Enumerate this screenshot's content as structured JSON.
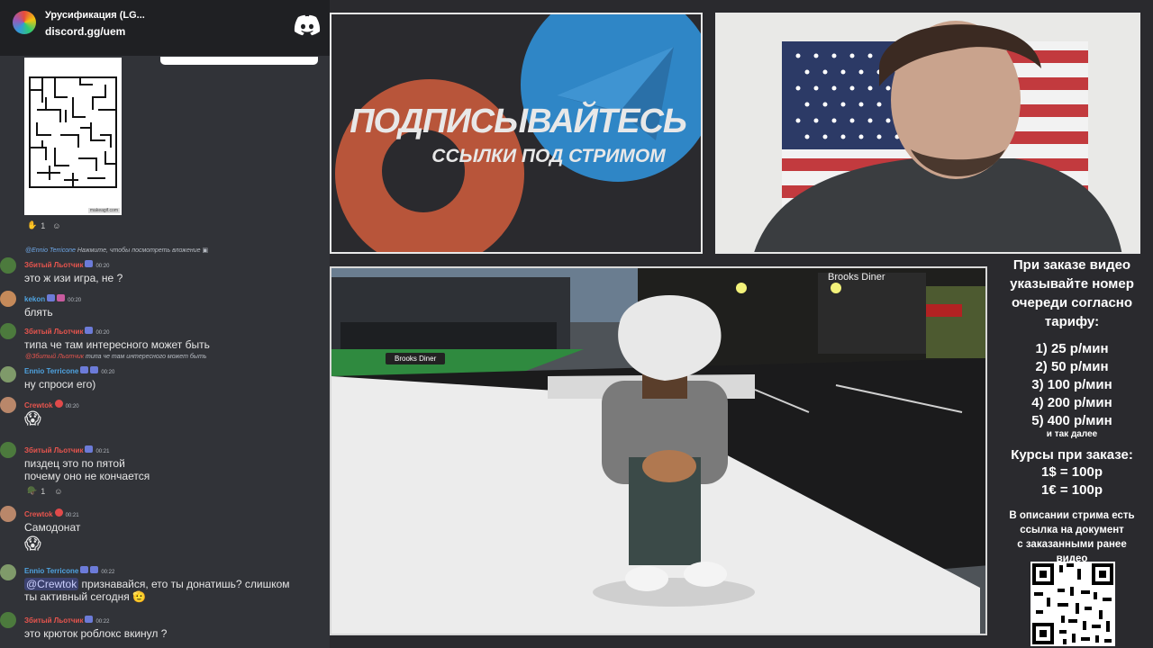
{
  "chat": {
    "server_name": "Урусификация (LG...",
    "server_invite": "discord.gg/uem",
    "maze_watermark": "makeagif.com",
    "maze_reactions": [
      {
        "icon": "raised-hand-icon",
        "count": "1"
      },
      {
        "icon": "add-reaction-icon",
        "count": ""
      }
    ],
    "messages": [
      {
        "reply_user": "@Ennio Terricone",
        "reply_text": "Нажмите, чтобы посмотреть вложение",
        "user": "Збитый Льотчик",
        "time": "00:20",
        "text": "это ж изи игра, не ?",
        "color": "#e8554e"
      },
      {
        "user": "kekon",
        "time": "00:20",
        "text": "блять",
        "color": "#4fa3e0"
      },
      {
        "user": "Збитый Льотчик",
        "time": "00:20",
        "text": "типа че там интересного может быть",
        "color": "#e8554e"
      },
      {
        "reply_user": "@Збитый Льотчик",
        "reply_text": "типа че там интересного может быть",
        "user": "Ennio Terricone",
        "time": "00:20",
        "text": "ну спроси его)",
        "color": "#4fa3e0"
      },
      {
        "user": "Crewtok",
        "time": "00:20",
        "text": "😱",
        "color": "#e8554e"
      },
      {
        "user": "Збитый Льотчик",
        "time": "00:21",
        "text": "пиздец  это по пятой",
        "text2": "почему оно не кончается",
        "color": "#e8554e",
        "reaction_count": "1"
      },
      {
        "user": "Crewtok",
        "time": "00:21",
        "text": "Самодонат",
        "color": "#e8554e"
      },
      {
        "user": "Crewtok",
        "time": "",
        "text": "😱",
        "color": "#e8554e"
      },
      {
        "user": "Ennio Terricone",
        "time": "00:22",
        "mention": "@Crewtok",
        "text": " признавайся, ето ты донатишь? слишком",
        "text2": "ты активный сегодня 🫡",
        "color": "#4fa3e0"
      },
      {
        "user": "Збитый Льотчик",
        "time": "00:22",
        "text": "это крюток роблокс вкинул ?",
        "color": "#e8554e"
      }
    ]
  },
  "promo": {
    "title": "ПОДПИСЫВАЙТЕСЬ",
    "subtitle": "ССЫЛКИ ПОД СТРИМОМ",
    "colors": {
      "patreon": "#b8553a",
      "telegram": "#2f86c6"
    }
  },
  "game": {
    "sign_top": "Brooks Diner",
    "sign_street": "Brooks Diner"
  },
  "info": {
    "heading": [
      "При заказе видео",
      "указывайте номер",
      "очереди согласно",
      "тарифу:"
    ],
    "prices": [
      "1) 25 р/мин",
      "2) 50 р/мин",
      "3) 100 р/мин",
      "4) 200 р/мин",
      "5) 400 р/мин"
    ],
    "prices_note": "и так далее",
    "rates_heading": "Курсы при заказе:",
    "rates": [
      "1$ = 100р",
      "1€ = 100р"
    ],
    "description": [
      "В описании стрима есть",
      "ссылка на документ",
      "с заказанными ранее",
      "видео"
    ]
  }
}
